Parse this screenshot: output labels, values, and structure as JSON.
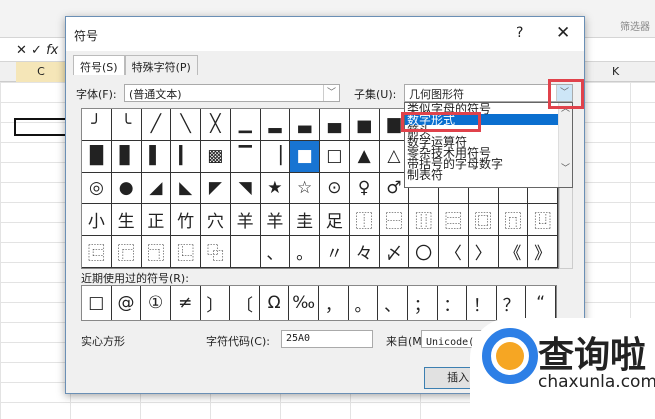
{
  "excel": {
    "ribbon_left": "插图",
    "ribbon_right": "筛选器",
    "fx": "fx",
    "col_c": "C",
    "col_k": "K"
  },
  "dialog": {
    "title": "符号",
    "help": "?",
    "close": "✕",
    "tabs": [
      "符号(S)",
      "特殊字符(P)"
    ],
    "font_label": "字体(F):",
    "font_value": "(普通文本)",
    "subset_label": "子集(U):",
    "subset_value": "几何图形符",
    "subset_options": [
      "类似字母的符号",
      "数字形式",
      "箭头",
      "数学运算符",
      "零杂技术用符号",
      "带括号的字母数字",
      "制表符"
    ],
    "subset_highlighted": "数字形式",
    "symbols": [
      [
        "╯",
        "╰",
        "╱",
        "╲",
        "╳",
        "▁",
        "▂",
        "▃",
        "▄",
        "▅",
        "▆",
        "",
        "",
        "",
        "",
        ""
      ],
      [
        "█",
        "▊",
        "▌",
        "▎",
        "▩",
        "▔",
        "▕",
        "■",
        "□",
        "▲",
        "△",
        "",
        "",
        "",
        "",
        ""
      ],
      [
        "◎",
        "●",
        "◢",
        "◣",
        "◤",
        "◥",
        "★",
        "☆",
        "⊙",
        "♀",
        "♂",
        "",
        "",
        "",
        "",
        ""
      ],
      [
        "小",
        "生",
        "正",
        "竹",
        "穴",
        "羊",
        "羊",
        "圭",
        "足",
        "⿰",
        "⿱",
        "⿲",
        "⿳",
        "⿴",
        "⿵",
        "⿶"
      ],
      [
        "⿷",
        "⿸",
        "⿹",
        "⿺",
        "⿻",
        "",
        "、",
        "。",
        "〃",
        "々",
        "〆",
        "〇",
        "〈",
        "〉",
        "《",
        "》"
      ]
    ],
    "selected_symbol": "■",
    "recent_label": "近期使用过的符号(R):",
    "recent": [
      "□",
      "@",
      "①",
      "≠",
      "〕",
      "〔",
      "Ω",
      "‰",
      "，",
      "。",
      "、",
      "；",
      "：",
      "！",
      "？",
      "“"
    ],
    "char_name": "实心方形",
    "code_label": "字符代码(C):",
    "code_value": "25A0",
    "from_label": "来自(M):",
    "from_value": "Unicode(十六进制)",
    "insert": "插入(I)"
  },
  "watermark": {
    "text": "查询啦",
    "url": "chaxunla.com"
  },
  "colors": {
    "highlight": "#0b6fcf",
    "annotation": "#e0424b"
  }
}
